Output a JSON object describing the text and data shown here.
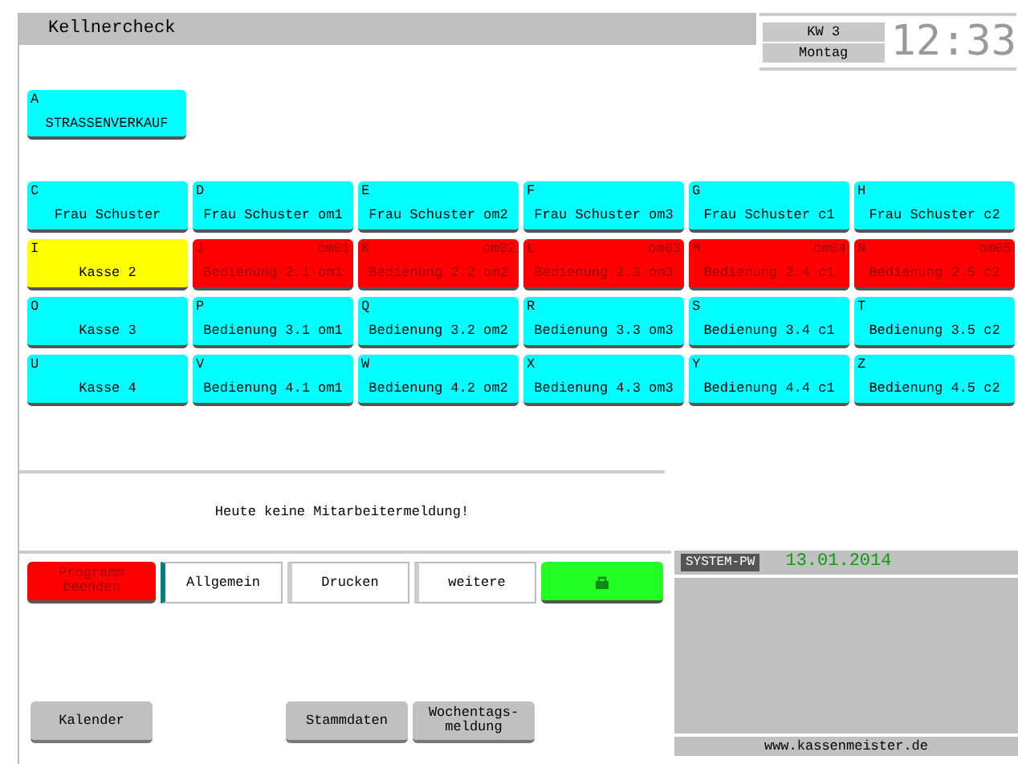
{
  "window": {
    "title": "Kellnercheck"
  },
  "clock": {
    "week": "KW 3",
    "weekday": "Montag",
    "time": "12:33"
  },
  "top_tile": {
    "letter": "A",
    "label": "STRASSENVERKAUF",
    "color": "#00ffff"
  },
  "tiles": [
    {
      "letter": "C",
      "label": "Frau Schuster",
      "color": "#00ffff"
    },
    {
      "letter": "D",
      "label": "Frau Schuster om1",
      "color": "#00ffff"
    },
    {
      "letter": "E",
      "label": "Frau Schuster om2",
      "color": "#00ffff"
    },
    {
      "letter": "F",
      "label": "Frau Schuster om3",
      "color": "#00ffff"
    },
    {
      "letter": "G",
      "label": "Frau Schuster c1",
      "color": "#00ffff"
    },
    {
      "letter": "H",
      "label": "Frau Schuster c2",
      "color": "#00ffff"
    },
    {
      "letter": "I",
      "label": "Kasse 2",
      "color": "#ffff00"
    },
    {
      "letter": "J",
      "code": "om01",
      "label": "Bedienung 2.1 om1",
      "color": "#ff0000"
    },
    {
      "letter": "K",
      "code": "om02",
      "label": "Bedienung 2.2 om2",
      "color": "#ff0000"
    },
    {
      "letter": "L",
      "code": "om03",
      "label": "Bedienung 2.3 om3",
      "color": "#ff0000"
    },
    {
      "letter": "M",
      "code": "om04",
      "label": "Bedienung 2.4 c1",
      "color": "#ff0000"
    },
    {
      "letter": "N",
      "code": "om05",
      "label": "Bedienung 2.5 c2",
      "color": "#ff0000"
    },
    {
      "letter": "O",
      "label": "Kasse 3",
      "color": "#00ffff"
    },
    {
      "letter": "P",
      "label": "Bedienung 3.1 om1",
      "color": "#00ffff"
    },
    {
      "letter": "Q",
      "label": "Bedienung 3.2 om2",
      "color": "#00ffff"
    },
    {
      "letter": "R",
      "label": "Bedienung 3.3 om3",
      "color": "#00ffff"
    },
    {
      "letter": "S",
      "label": "Bedienung 3.4 c1",
      "color": "#00ffff"
    },
    {
      "letter": "T",
      "label": "Bedienung 3.5 c2",
      "color": "#00ffff"
    },
    {
      "letter": "U",
      "label": "Kasse 4",
      "color": "#00ffff"
    },
    {
      "letter": "V",
      "label": "Bedienung 4.1 om1",
      "color": "#00ffff"
    },
    {
      "letter": "W",
      "label": "Bedienung 4.2 om2",
      "color": "#00ffff"
    },
    {
      "letter": "X",
      "label": "Bedienung 4.3 om3",
      "color": "#00ffff"
    },
    {
      "letter": "Y",
      "label": "Bedienung 4.4 c1",
      "color": "#00ffff"
    },
    {
      "letter": "Z",
      "label": "Bedienung 4.5 c2",
      "color": "#00ffff"
    }
  ],
  "message": "Heute keine Mitarbeitermeldung!",
  "menu": [
    {
      "kind": "exit",
      "label": "Programm beenden"
    },
    {
      "kind": "tab",
      "label": "Allgemein",
      "selected": true
    },
    {
      "kind": "tab",
      "label": "Drucken",
      "selected": false
    },
    {
      "kind": "tab",
      "label": "weitere",
      "selected": false
    },
    {
      "kind": "lock"
    }
  ],
  "bottom_buttons": [
    {
      "label": "Kalender"
    },
    {
      "label": "Stammdaten"
    },
    {
      "label": "Wochentags-\nmeldung"
    }
  ],
  "system": {
    "badge": "SYSTEM-PW",
    "date": "13.01.2014",
    "website": "www.kassenmeister.de"
  }
}
